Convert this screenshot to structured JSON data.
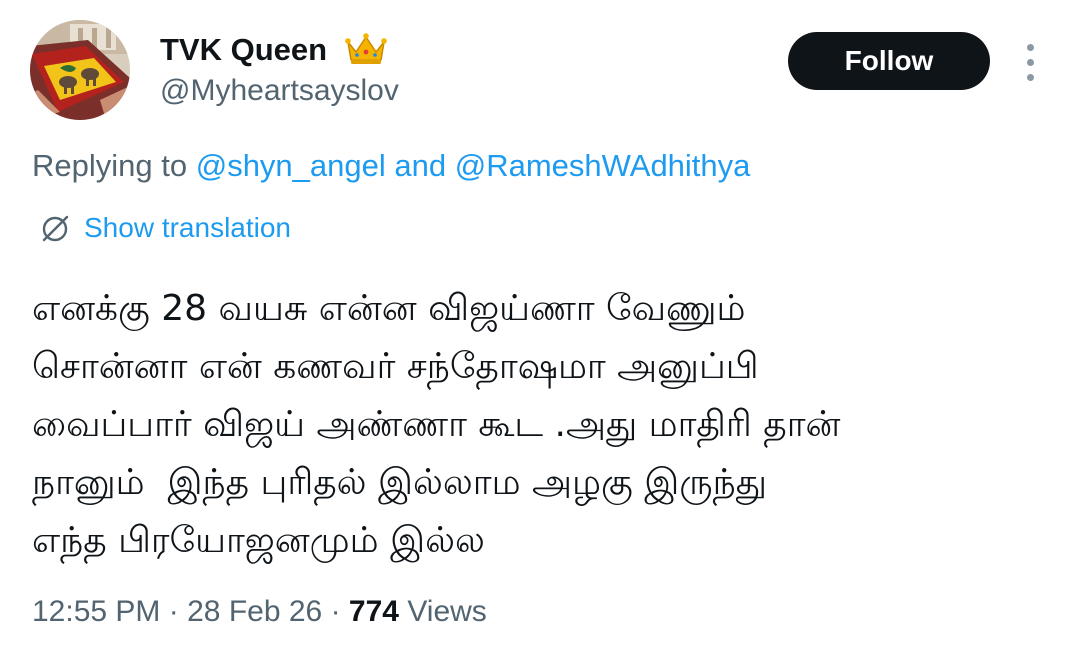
{
  "author": {
    "name": "TVK Queen",
    "handle": "@Myheartsayslov",
    "badge_icon": "crown-icon"
  },
  "follow_button": {
    "label": "Follow"
  },
  "more_options": {
    "icon": "more-vertical-icon"
  },
  "reply": {
    "prefix": "Replying to",
    "first_user": "@shyn_angel",
    "conjunction": "and",
    "second_user": "@RameshWAdhithya"
  },
  "translation": {
    "icon": "globe-icon",
    "label": "Show translation"
  },
  "tweet": {
    "lines": [
      "எனக்கு 28 வயசு என்ன விஜய்ணா வேணும்",
      "சொன்னா என் கணவர் சந்தோஷமா அனுப்பி",
      "வைப்பார் விஜய் அண்ணா கூட .அது மாதிரி தான்",
      "நானும்  இந்த புரிதல் இல்லாம அழகு இருந்து",
      "எந்த பிரயோஜனமும் இல்ல"
    ]
  },
  "meta": {
    "time": "12:55 PM",
    "separator": "·",
    "date": "28 Feb 26",
    "views_count": "774",
    "views_label": "Views"
  },
  "colors": {
    "text_primary": "#0f1419",
    "text_secondary": "#536471",
    "link": "#1d9bf0",
    "button_bg": "#0f1419",
    "button_text": "#ffffff",
    "crown": "#f4b400"
  }
}
